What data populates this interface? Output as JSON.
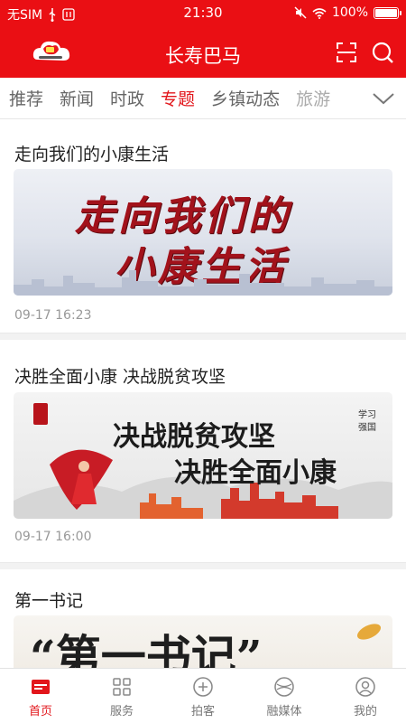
{
  "status_bar": {
    "carrier": "无SIM",
    "time": "21:30",
    "battery": "100%",
    "battery_level": 1.0
  },
  "header": {
    "title": "长寿巴马",
    "icons": [
      "app-logo",
      "scan-icon",
      "search-icon"
    ]
  },
  "tabs": {
    "items": [
      "推荐",
      "新闻",
      "时政",
      "专题",
      "乡镇动态",
      "旅游"
    ],
    "active": "专题"
  },
  "articles": [
    {
      "title": "走向我们的小康生活",
      "banner_lines": [
        "走向我们的",
        "小康生活"
      ],
      "time": "09-17 16:23"
    },
    {
      "title": "决胜全面小康 决战脱贫攻坚",
      "banner_lines": [
        "决战脱贫攻坚",
        "决胜全面小康"
      ],
      "banner_side": [
        "学习",
        "强国"
      ],
      "time": "09-17 16:00"
    },
    {
      "title": "第一书记",
      "banner_text": "“第一书记”"
    }
  ],
  "bottom_nav": {
    "items": [
      {
        "label": "首页",
        "icon": "home-icon"
      },
      {
        "label": "服务",
        "icon": "grid-icon"
      },
      {
        "label": "拍客",
        "icon": "plus-circle-icon"
      },
      {
        "label": "融媒体",
        "icon": "media-icon"
      },
      {
        "label": "我的",
        "icon": "user-icon"
      }
    ],
    "active": "首页"
  },
  "colors": {
    "brand_red": "#ea0f14",
    "active_tab": "#e2161b",
    "muted_text": "#999999"
  }
}
